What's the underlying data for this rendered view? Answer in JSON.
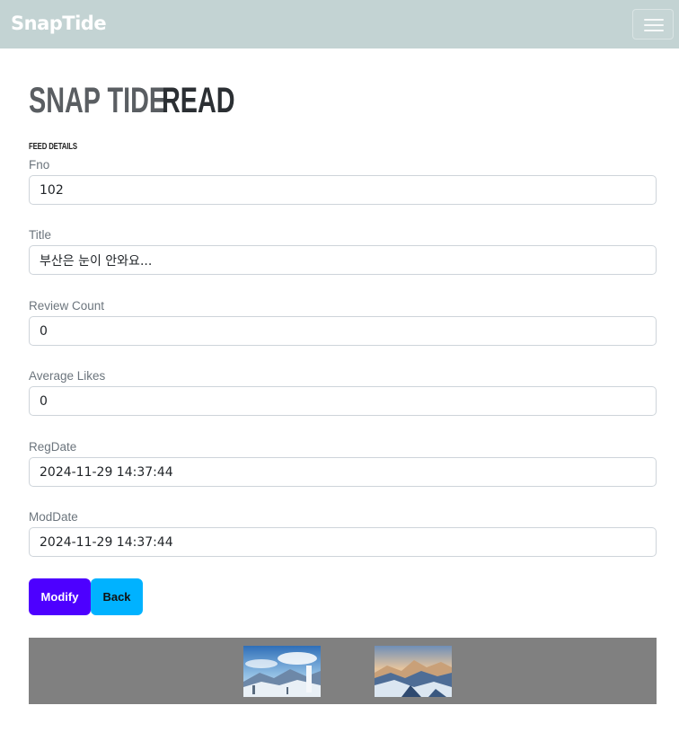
{
  "app": {
    "brand": "SnapTide"
  },
  "heading": {
    "brand": "SNAP TIDE",
    "page": "READ"
  },
  "section_label": "FEED DETAILS",
  "fields": [
    {
      "label": "Fno",
      "value": "102"
    },
    {
      "label": "Title",
      "value": "부산은 눈이 안와요..."
    },
    {
      "label": "Review Count",
      "value": "0"
    },
    {
      "label": "Average Likes",
      "value": "0"
    },
    {
      "label": "RegDate",
      "value": "2024-11-29 14:37:44"
    },
    {
      "label": "ModDate",
      "value": "2024-11-29 14:37:44"
    }
  ],
  "buttons": {
    "modify": "Modify",
    "back": "Back"
  },
  "colors": {
    "navbar": "#c3d3d3",
    "modify": "#4d00ff",
    "back": "#00b2ff",
    "gallery_bg": "#808080"
  },
  "images": [
    {
      "name": "snowy-mountain-sky-photo"
    },
    {
      "name": "snowy-mountain-sunrise-photo"
    }
  ]
}
